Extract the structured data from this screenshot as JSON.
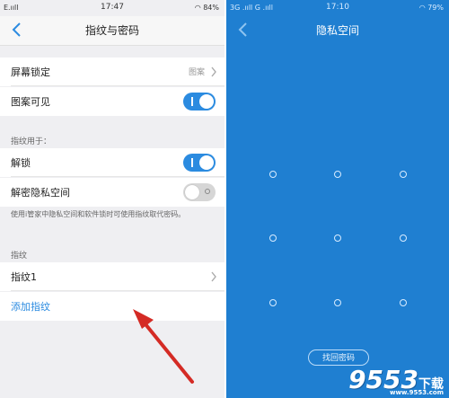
{
  "left": {
    "status": {
      "carrier": "E.ııll",
      "time": "17:47",
      "battery": "84%"
    },
    "nav": {
      "title": "指纹与密码"
    },
    "screen_lock": {
      "label": "屏幕锁定",
      "value": "图案"
    },
    "pattern_visible": {
      "label": "图案可见",
      "on": true
    },
    "section_fingerprint_use": "指纹用于：",
    "unlock": {
      "label": "解锁",
      "on": true
    },
    "unlock_private": {
      "label": "解密隐私空间",
      "on": false
    },
    "note": "使用i管家中隐私空间和软件锁时可使用指纹取代密码。",
    "section_fingerprint": "指纹",
    "fingerprint1": {
      "label": "指纹1"
    },
    "add_fingerprint": "添加指纹"
  },
  "right": {
    "status": {
      "carrier": "3G .ııll G .ııll",
      "time": "17:10",
      "battery": "79%"
    },
    "nav": {
      "title": "隐私空间"
    },
    "retrieve_password": "找回密码"
  },
  "watermark": {
    "number": "9553",
    "text": "下载",
    "domain": "www.9553.com"
  },
  "colors": {
    "accent": "#2b8be0",
    "right_bg": "#1f7fd1",
    "arrow": "#d42b25"
  }
}
